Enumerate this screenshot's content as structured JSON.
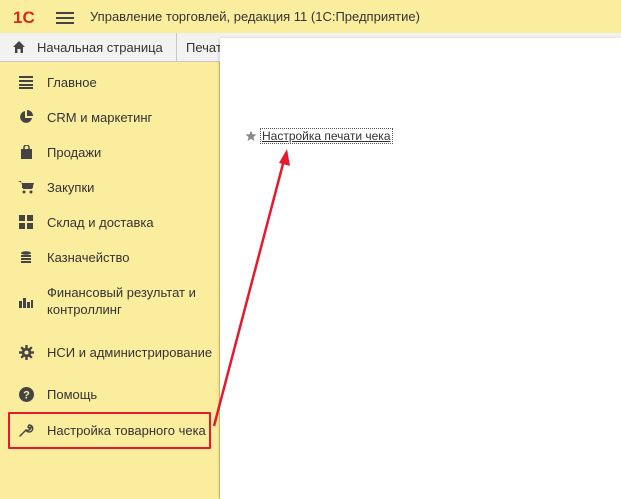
{
  "header": {
    "logo_text": "1С",
    "app_title": "Управление торговлей, редакция 11  (1С:Предприятие)"
  },
  "tabs": [
    {
      "label": "Начальная страница"
    },
    {
      "label": "Печат"
    }
  ],
  "sidebar": {
    "items": [
      {
        "label": "Главное",
        "icon": "menu-lines-icon"
      },
      {
        "label": "CRM и маркетинг",
        "icon": "pie-chart-icon"
      },
      {
        "label": "Продажи",
        "icon": "shopping-bag-icon"
      },
      {
        "label": "Закупки",
        "icon": "shopping-cart-icon"
      },
      {
        "label": "Склад и доставка",
        "icon": "warehouse-grid-icon"
      },
      {
        "label": "Казначейство",
        "icon": "coins-icon"
      },
      {
        "label": "Финансовый результат и контроллинг",
        "icon": "bar-chart-icon"
      },
      {
        "label": "НСИ и администрирование",
        "icon": "gear-icon"
      },
      {
        "label": "Помощь",
        "icon": "help-icon"
      },
      {
        "label": "Настройка товарного чека",
        "icon": "wrench-icon"
      }
    ]
  },
  "main": {
    "link_label": "Настройка печати чека"
  },
  "colors": {
    "sidebar_bg": "#fbed9e",
    "highlight": "#e8192c",
    "logo": "#d52b1e"
  }
}
